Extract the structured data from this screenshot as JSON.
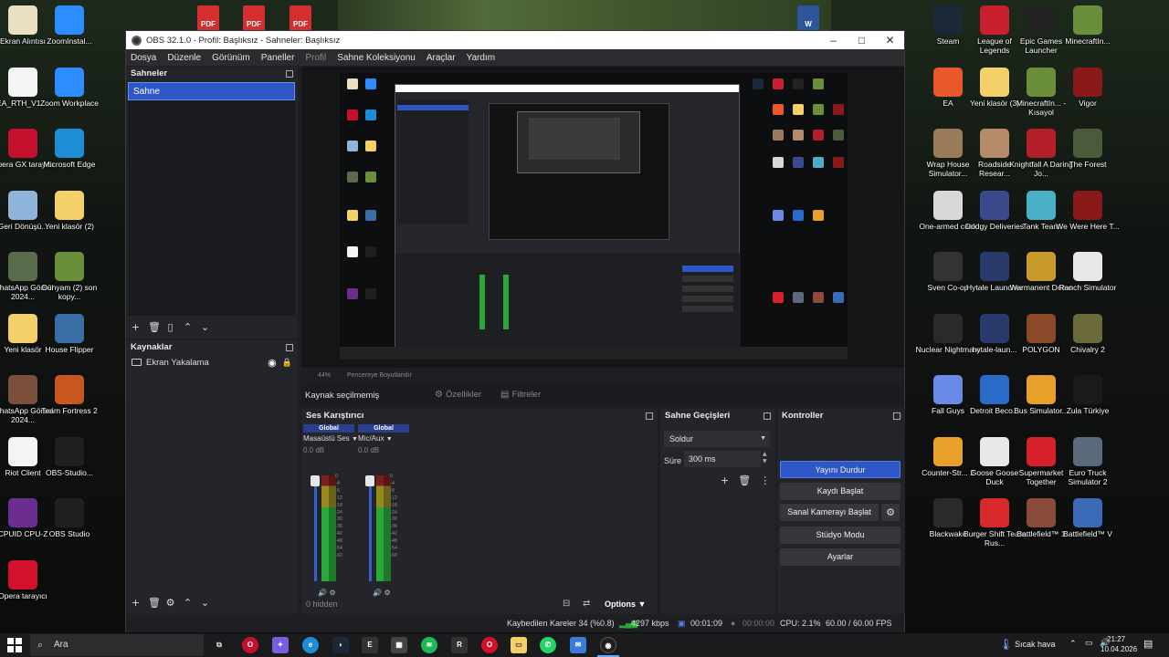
{
  "colors": {
    "accent": "#2f56c6",
    "meter_green": "#2aa83a",
    "meter_yellow": "#9a8a1e",
    "meter_red": "#7a1e1e"
  },
  "top_files": [
    {
      "label": "PDF",
      "color": "#d32f2f"
    },
    {
      "label": "PDF",
      "color": "#d32f2f"
    },
    {
      "label": "PDF",
      "color": "#d32f2f"
    },
    {
      "label": "W",
      "color": "#2b579a"
    }
  ],
  "desktop_left": [
    {
      "label": "Ekran Alıntısı",
      "icon": "snipping-tool-icon",
      "color": "#e9e0c2"
    },
    {
      "label": "ZoomInstal...",
      "icon": "zoom-icon",
      "color": "#2d8cff"
    },
    {
      "label": "EA_RTH_V1....",
      "icon": "document-icon",
      "color": "#f4f4f4"
    },
    {
      "label": "Zoom Workplace",
      "icon": "zoom-icon",
      "color": "#2d8cff"
    },
    {
      "label": "Opera GX tarayıcı",
      "icon": "opera-gx-icon",
      "color": "#c4102d"
    },
    {
      "label": "Microsoft Edge",
      "icon": "edge-icon",
      "color": "#1d8ed6"
    },
    {
      "label": "Geri Dönüşü...",
      "icon": "recycle-bin-icon",
      "color": "#8fb4d9"
    },
    {
      "label": "Yeni klasör (2)",
      "icon": "folder-icon",
      "color": "#f3d068"
    },
    {
      "label": "WhatsApp Görsel 2024...",
      "icon": "image-icon",
      "color": "#5a6b4c"
    },
    {
      "label": "Dünyam (2) son kopy...",
      "icon": "minecraft-icon",
      "color": "#6b8e3a"
    },
    {
      "label": "Yeni klasör",
      "icon": "folder-icon",
      "color": "#f3d068"
    },
    {
      "label": "House Flipper",
      "icon": "house-flipper-icon",
      "color": "#3b6ea5"
    },
    {
      "label": "WhatsApp Görsel 2024...",
      "icon": "image-icon",
      "color": "#7a4f3b"
    },
    {
      "label": "Team Fortress 2",
      "icon": "tf2-icon",
      "color": "#c8561f"
    },
    {
      "label": "Riot Client",
      "icon": "document-icon",
      "color": "#f4f4f4"
    },
    {
      "label": "OBS-Studio...",
      "icon": "obs-icon",
      "color": "#202020"
    },
    {
      "label": "CPUID CPU-Z",
      "icon": "cpuz-icon",
      "color": "#6b2d8e"
    },
    {
      "label": "OBS Studio",
      "icon": "obs-icon",
      "color": "#202020"
    },
    {
      "label": "Opera tarayıcı",
      "icon": "opera-icon",
      "color": "#d3112b"
    }
  ],
  "desktop_right": [
    {
      "label": "Steam",
      "icon": "steam-icon",
      "color": "#1b2838"
    },
    {
      "label": "League of Legends",
      "icon": "lol-icon",
      "color": "#c8202f"
    },
    {
      "label": "Epic Games Launcher",
      "icon": "epic-icon",
      "color": "#222222"
    },
    {
      "label": "MinecraftIn...",
      "icon": "minecraft-icon",
      "color": "#6b8e3a"
    },
    {
      "label": "EA",
      "icon": "ea-icon",
      "color": "#e8582a"
    },
    {
      "label": "Yeni klasör (3)",
      "icon": "folder-icon",
      "color": "#f3d068"
    },
    {
      "label": "MinecraftIn... - Kısayol",
      "icon": "minecraft-icon",
      "color": "#6b8e3a"
    },
    {
      "label": "Vigor",
      "icon": "vigor-icon",
      "color": "#8a1a1a"
    },
    {
      "label": "Wrap House Simulator...",
      "icon": "game-icon",
      "color": "#9a7b5a"
    },
    {
      "label": "Roadside Resear...",
      "icon": "game-icon",
      "color": "#b58b6a"
    },
    {
      "label": "Knightfall A Daring Jo...",
      "icon": "game-icon",
      "color": "#b3202a"
    },
    {
      "label": "The Forest",
      "icon": "game-icon",
      "color": "#4a5a3a"
    },
    {
      "label": "One-armed cook",
      "icon": "game-icon",
      "color": "#d8d8d8"
    },
    {
      "label": "Dodgy Deliveries",
      "icon": "game-icon",
      "color": "#3a4a8a"
    },
    {
      "label": "Tank Team",
      "icon": "game-icon",
      "color": "#4ab0c8"
    },
    {
      "label": "We Were Here T...",
      "icon": "game-icon",
      "color": "#8a1a1a"
    },
    {
      "label": "Sven Co-op",
      "icon": "game-icon",
      "color": "#333333"
    },
    {
      "label": "Hytale Launcher",
      "icon": "hytale-icon",
      "color": "#2a3a6a"
    },
    {
      "label": "Warmanent Demo",
      "icon": "game-icon",
      "color": "#c89a2a"
    },
    {
      "label": "Ranch Simulator",
      "icon": "game-icon",
      "color": "#e8e8e8"
    },
    {
      "label": "Nuclear Nightmare",
      "icon": "game-icon",
      "color": "#2a2a2a"
    },
    {
      "label": "hytale-laun...",
      "icon": "hytale-icon",
      "color": "#2a3a6a"
    },
    {
      "label": "POLYGON",
      "icon": "game-icon",
      "color": "#8a4a2a"
    },
    {
      "label": "Chivalry 2",
      "icon": "game-icon",
      "color": "#6a6a3a"
    },
    {
      "label": "Fall Guys",
      "icon": "game-icon",
      "color": "#6a8ae8"
    },
    {
      "label": "Detroit Beco...",
      "icon": "game-icon",
      "color": "#2a6ac8"
    },
    {
      "label": "Bus Simulator...",
      "icon": "game-icon",
      "color": "#e8a02a"
    },
    {
      "label": "Zula Türkiye",
      "icon": "game-icon",
      "color": "#1a1a1a"
    },
    {
      "label": "Counter-Str... 2",
      "icon": "cs2-icon",
      "color": "#e8a02a"
    },
    {
      "label": "Goose Goose Duck",
      "icon": "game-icon",
      "color": "#e8e8e8"
    },
    {
      "label": "Supermarket Together",
      "icon": "game-icon",
      "color": "#d8202a"
    },
    {
      "label": "Euro Truck Simulator 2",
      "icon": "game-icon",
      "color": "#5a6a7a"
    },
    {
      "label": "Blackwake",
      "icon": "game-icon",
      "color": "#2a2a2a"
    },
    {
      "label": "Burger Shift Team Rus...",
      "icon": "game-icon",
      "color": "#d82a2a"
    },
    {
      "label": "Battlefield™ 1",
      "icon": "game-icon",
      "color": "#8a4a3a"
    },
    {
      "label": "Battlefield™ V",
      "icon": "game-icon",
      "color": "#3a6ab8"
    }
  ],
  "obs": {
    "title": "OBS 32.1.0 - Profil: Başlıksız - Sahneler: Başlıksız",
    "menu": [
      "Dosya",
      "Düzenle",
      "Görünüm",
      "Paneller",
      "Profil",
      "Sahne Koleksiyonu",
      "Araçlar",
      "Yardım"
    ],
    "scenes": {
      "title": "Sahneler",
      "items": [
        "Sahne"
      ]
    },
    "sources": {
      "title": "Kaynaklar",
      "items": [
        "Ekran Yakalama"
      ]
    },
    "zoom": "44%",
    "zoom_mode": "Pencereye Boyutlandır",
    "source_bar": {
      "no_source": "Kaynak seçilmemiş",
      "properties": "Özellikler",
      "filters": "Filtreler"
    },
    "mixer": {
      "title": "Ses Karıştırıcı",
      "channels": [
        {
          "badge": "Global",
          "name": "Masaüstü Ses",
          "db": "0.0 dB"
        },
        {
          "badge": "Global",
          "name": "Mic/Aux",
          "db": "0.0 dB"
        }
      ],
      "ticks": [
        "0",
        "-4",
        "-8",
        "-12",
        "-18",
        "-24",
        "-30",
        "-36",
        "-42",
        "-48",
        "-54",
        "-60"
      ],
      "hidden": "0 hidden",
      "options": "Options"
    },
    "transitions": {
      "title": "Sahne Geçişleri",
      "selected": "Soldur",
      "duration_label": "Süre",
      "duration": "300 ms"
    },
    "controls": {
      "title": "Kontroller",
      "stop_stream": "Yayını Durdur",
      "start_record": "Kaydı Başlat",
      "virtual_cam": "Sanal Kamerayı Başlat",
      "studio_mode": "Stüdyo Modu",
      "settings": "Ayarlar"
    },
    "status": {
      "dropped": "Kaybedilen Kareler 34 (%0.8)",
      "bitrate": "4297 kbps",
      "stream_time": "00:01:09",
      "record_time": "00:00:00",
      "cpu": "CPU: 2.1%",
      "fps": "60.00 / 60.00 FPS"
    }
  },
  "taskbar": {
    "search_placeholder": "Ara",
    "weather": "Sıcak hava",
    "time": "21:27",
    "date": "10.04.2026"
  }
}
